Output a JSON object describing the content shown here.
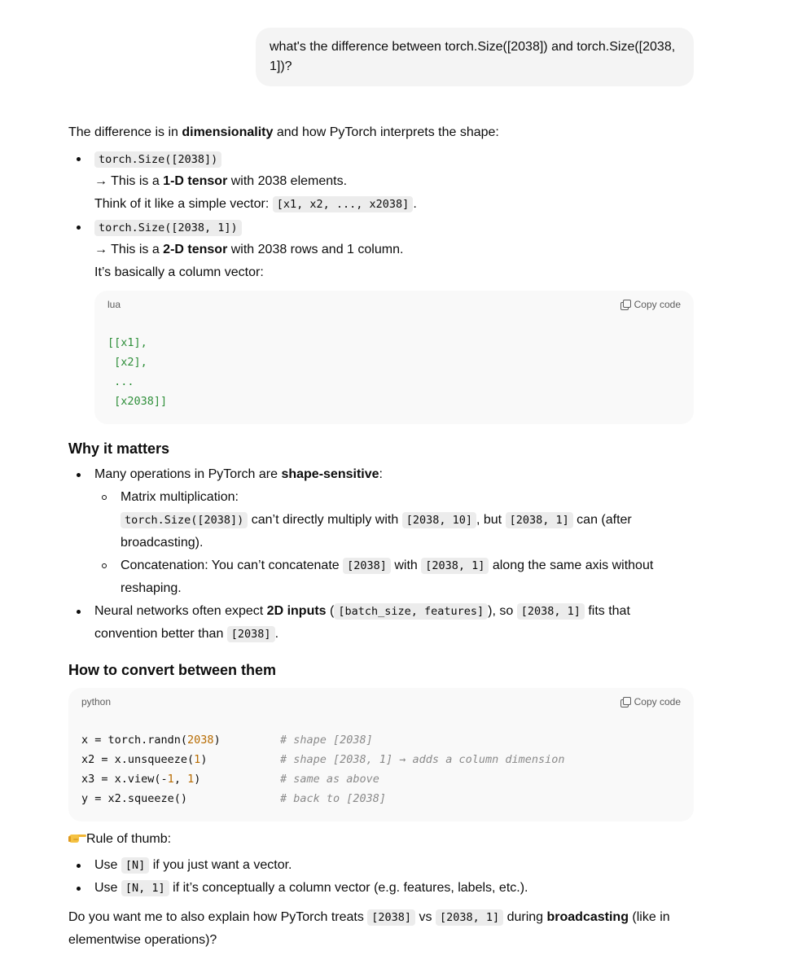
{
  "user_message": "what's the difference between torch.Size([2038]) and torch.Size([2038, 1])?",
  "intro": {
    "t1": "The difference is in ",
    "b1": "dimensionality",
    "t2": " and how PyTorch interprets the shape:"
  },
  "item1": {
    "code": "torch.Size([2038])",
    "l1a": "→ This is a ",
    "l1b": "1-D tensor",
    "l1c": " with 2038 elements.",
    "l2a": "Think of it like a simple vector: ",
    "l2code": "[x1, x2, ..., x2038]",
    "l2b": "."
  },
  "item2": {
    "code": "torch.Size([2038, 1])",
    "l1a": "→ This is a ",
    "l1b": "2-D tensor",
    "l1c": " with 2038 rows and 1 column.",
    "l2": "It’s basically a column vector:"
  },
  "codeblock1": {
    "lang": "lua",
    "copy": "Copy code",
    "lines": [
      "[[x1],",
      " [x2],",
      " ...",
      " [x2038]]"
    ]
  },
  "why": {
    "heading": "Why it matters",
    "b1a": "Many operations in PyTorch are ",
    "b1b": "shape-sensitive",
    "b1c": ":",
    "s1": "Matrix multiplication:",
    "s1c1": "torch.Size([2038])",
    "s1t1": " can’t directly multiply with ",
    "s1c2": "[2038, 10]",
    "s1t2": ", but ",
    "s1c3": "[2038, 1]",
    "s1t3": " can (after",
    "s1t4": "broadcasting).",
    "s2a": "Concatenation: You can’t concatenate ",
    "s2c1": "[2038]",
    "s2b": " with ",
    "s2c2": "[2038, 1]",
    "s2c": " along the same axis without",
    "s2d": "reshaping.",
    "b2a": "Neural networks often expect ",
    "b2b": "2D inputs",
    "b2c": " (",
    "b2code": "[batch_size, features]",
    "b2d": "), so ",
    "b2code2": "[2038, 1]",
    "b2e": " fits that",
    "b2f": "convention better than ",
    "b2code3": "[2038]",
    "b2g": "."
  },
  "convert": {
    "heading": "How to convert between them",
    "lang": "python",
    "copy": "Copy code",
    "rows": [
      {
        "a": "x = torch.randn(",
        "n": "2038",
        "b": ")",
        "comment": "# shape [2038]"
      },
      {
        "a": "x2 = x.unsqueeze(",
        "n": "1",
        "b": ")",
        "comment": "# shape [2038, 1] → adds a column dimension"
      },
      {
        "a": "x3 = x.view(-",
        "n": "1",
        "m": ", ",
        "n2": "1",
        "b": ")",
        "comment": "# same as above"
      },
      {
        "a": "y = x2.squeeze()",
        "comment": "# back to [2038]"
      }
    ]
  },
  "rule": {
    "title": "Rule of thumb:",
    "r1a": "Use ",
    "r1code": "[N]",
    "r1b": " if you just want a vector.",
    "r2a": "Use ",
    "r2code": "[N, 1]",
    "r2b": " if it’s conceptually a column vector (e.g. features, labels, etc.)."
  },
  "closing": {
    "a": "Do you want me to also explain how PyTorch treats ",
    "c1": "[2038]",
    "b": " vs ",
    "c2": "[2038, 1]",
    "c": " during ",
    "bold": "broadcasting",
    "d": " (like in",
    "e": "elementwise operations)?"
  },
  "colors": {
    "bubble": "#f4f4f4",
    "code_bg": "#f9f9f9",
    "inline_code_bg": "#ececec",
    "string": "#2f8f3a",
    "number": "#b76b01",
    "comment": "#8a8a8a"
  }
}
